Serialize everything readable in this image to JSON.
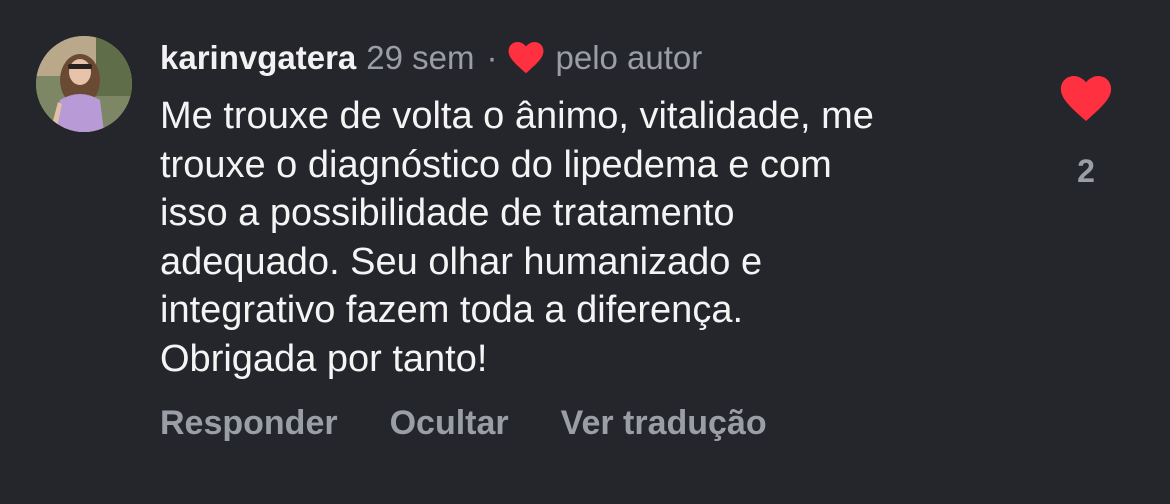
{
  "comment": {
    "username": "karinvgatera",
    "time": "29 sem",
    "separator": "·",
    "liked_by_author": "pelo autor",
    "text_lines": [
      "Me trouxe de volta o ânimo, vitalidade, me",
      "trouxe o diagnóstico do lipedema e com",
      "isso a possibilidade de tratamento",
      "adequado. Seu olhar humanizado e",
      "integrativo fazem toda a diferença.",
      "Obrigada por tanto!"
    ],
    "like_count": "2"
  },
  "actions": {
    "reply": "Responder",
    "hide": "Ocultar",
    "translate": "Ver tradução"
  },
  "colors": {
    "background": "#25262b",
    "heart": "#ff3040",
    "muted_text": "#9a9ea7",
    "primary_text": "#f4f4f4"
  }
}
